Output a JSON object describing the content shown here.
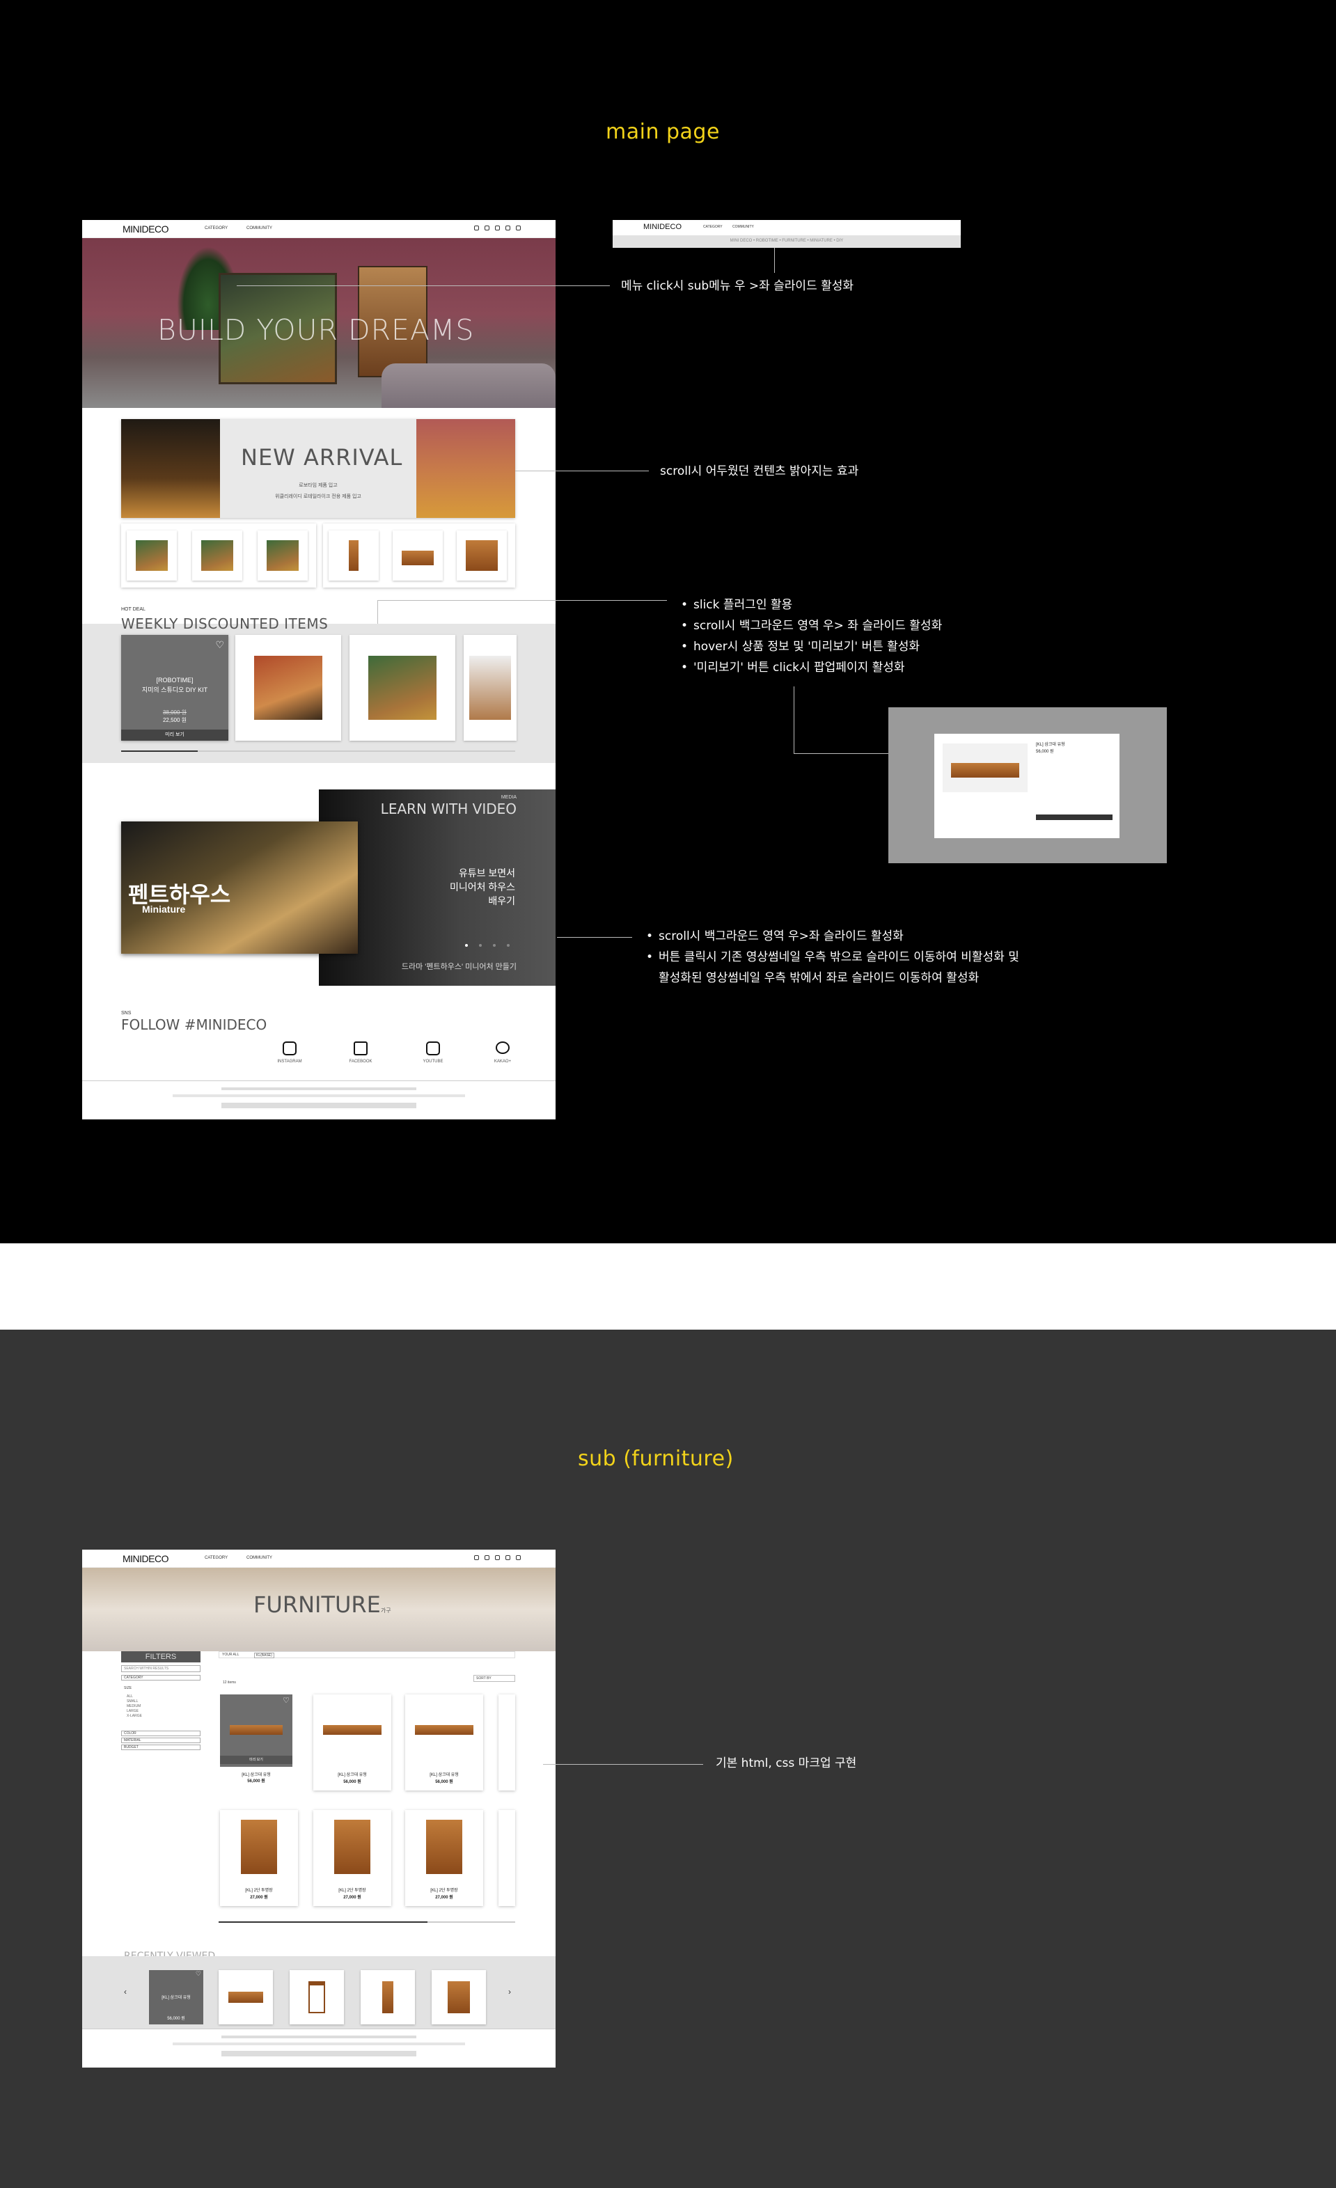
{
  "sections": {
    "main_title": "main page",
    "sub_title": "sub (furniture)"
  },
  "header": {
    "logo": "MINIDECO",
    "nav": [
      "CATEGORY",
      "COMMUNITY"
    ],
    "submenu_path": "MINI DECO • ROBOTIME • FURNITURE • MINIATURE • DIY"
  },
  "hero": {
    "title": "BUILD YOUR DREAMS"
  },
  "new_arrival": {
    "title": "NEW ARRIVAL",
    "line1": "로보타임 제품 입고",
    "line2": "위클리레이디 로테일라이크 전용 제품 입고"
  },
  "hot_deal": {
    "label": "HOT DEAL",
    "title": "WEEKLY DISCOUNTED ITEMS",
    "card_brand": "[ROBOTIME]",
    "card_name": "지미의 스튜디오 DIY KIT",
    "price_old": "38,000 원",
    "price_new": "22,500 원",
    "preview_label": "미리 보기"
  },
  "popup": {
    "name": "[KL] 삼크대 유형",
    "price": "56,000 원"
  },
  "video": {
    "media_label": "MEDIA",
    "title": "LEARN WITH VIDEO",
    "thumb_title": "펜트하우스",
    "thumb_sub": "Miniature",
    "heading1": "유튜브 보면서",
    "heading2": "미니어처 하우스",
    "heading3": "배우기",
    "caption": "드라마 '펜트하우스' 미니어처 만들기"
  },
  "sns": {
    "label": "SNS",
    "title": "FOLLOW #MINIDECO",
    "items": [
      {
        "label": "INSTAGRAM",
        "icon": "instagram-icon"
      },
      {
        "label": "FACEBOOK",
        "icon": "facebook-icon"
      },
      {
        "label": "YOUTUBE",
        "icon": "youtube-icon"
      },
      {
        "label": "KAKAO+",
        "icon": "kakao-icon"
      }
    ]
  },
  "annotations": {
    "menu": "메뉴 click시 sub메뉴 우 >좌 슬라이드 활성화",
    "scroll": "scroll시 어두웠던 컨텐츠 밝아지는 효과",
    "slick": [
      "slick 플러그인 활용",
      "scroll시 백그라운드 영역 우> 좌 슬라이드 활성화",
      "hover시 상품 정보 및 '미리보기' 버튼 활성화",
      "'미리보기' 버튼 click시 팝업페이지 활성화"
    ],
    "video": [
      "scroll시 백그라운드 영역 우>좌 슬라이드 활성화",
      "버튼 클릭시 기존 영상썸네일 우측 밖으로 슬라이드 이동하여 비활성화 및"
    ],
    "video_cont": "활성화된 영상썸네일 우측 밖에서 좌로 슬라이드 이동하여 활성화",
    "sub": "기본 html, css 마크업 구현"
  },
  "sub_page": {
    "title": "FURNITURE",
    "title_sup": "가구",
    "filters_title": "FILTERS",
    "search_placeholder": "SEARCH WITHIN RESULTS",
    "category": "CATEGORY",
    "size": "SIZE",
    "size_options": [
      "ALL",
      "SMALL",
      "MEDIUM",
      "LARGE",
      "X-LARGE"
    ],
    "color": "COLOR",
    "material": "MATERIAL",
    "budget": "BUDGET",
    "your_all": "YOUR ALL",
    "tag": "KL(BASE)",
    "sort": "SORT BY",
    "count": "12 items",
    "products_row1": [
      {
        "name": "[KL] 삼크대 유형",
        "price": "56,000 원"
      },
      {
        "name": "[KL] 삼크대 유형",
        "price": "56,000 원"
      },
      {
        "name": "[KL] 삼크대 유형",
        "price": "56,000 원"
      }
    ],
    "products_row2": [
      {
        "name": "[KL] 2단 투명장",
        "price": "27,000 원"
      },
      {
        "name": "[KL] 2단 투명장",
        "price": "27,000 원"
      },
      {
        "name": "[KL] 2단 투명장",
        "price": "27,000 원"
      }
    ],
    "quick_view": "미리 보기",
    "recently_viewed": "RECENTLY VIEWED",
    "recent_card_name": "[KL] 삼크대 유형",
    "recent_card_price": "56,000 원"
  },
  "colors": {
    "accent": "#f2d31a",
    "dark_band": "#000000",
    "gray_band": "#353535"
  }
}
